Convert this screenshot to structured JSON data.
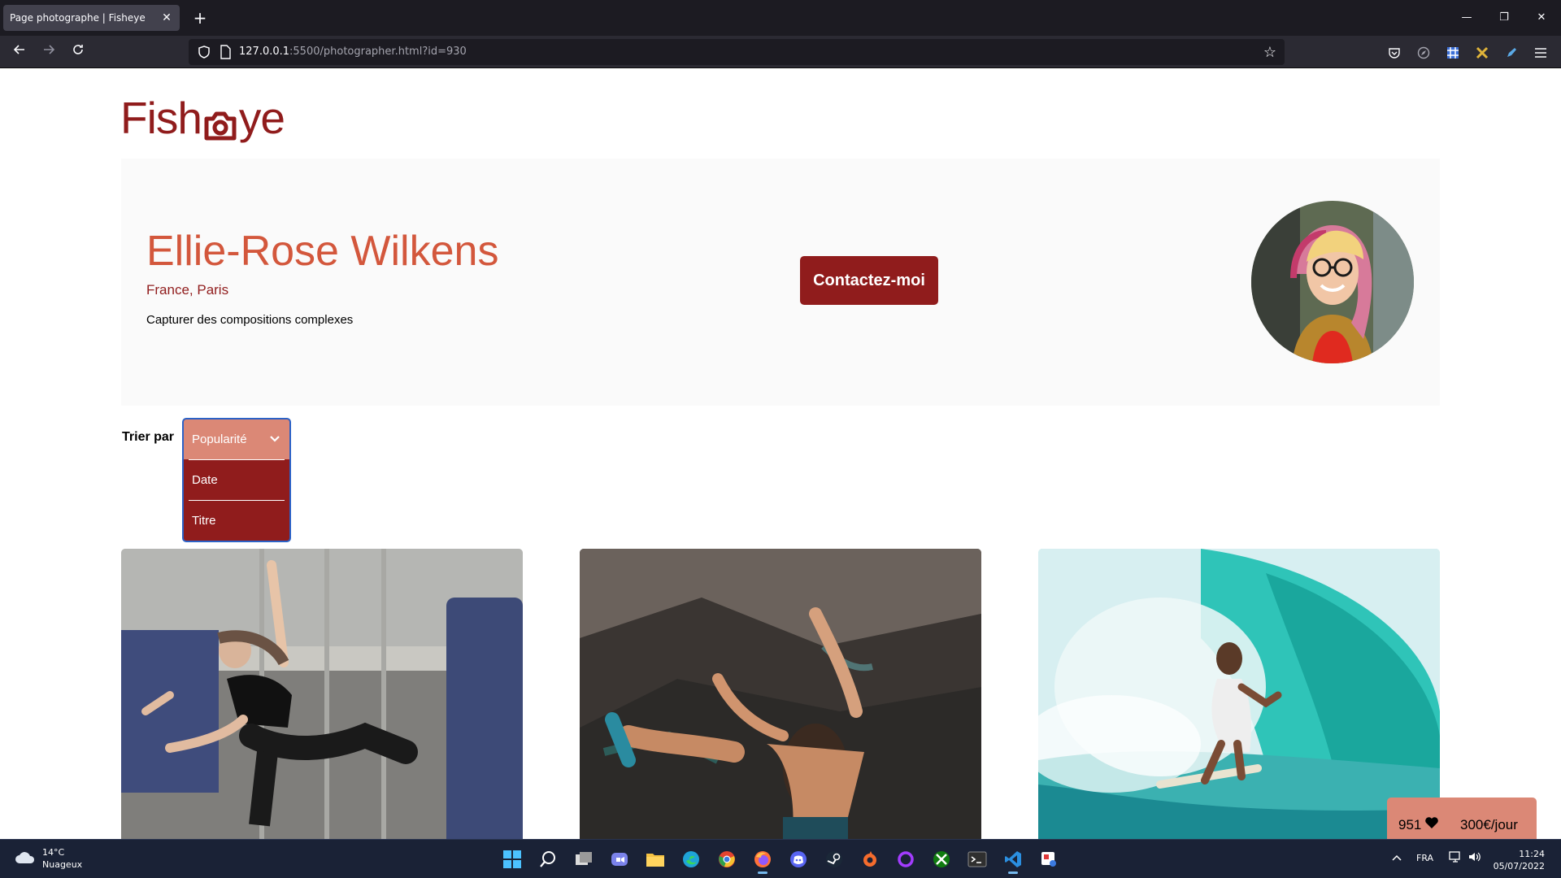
{
  "browser": {
    "tab_title": "Page photographe | Fisheye",
    "tab_close": "✕",
    "new_tab": "+",
    "url_host": "127.0.0.1",
    "url_rest": ":5500/photographer.html?id=930",
    "window_controls": {
      "minimize": "—",
      "restore": "❐",
      "close": "✕"
    }
  },
  "site": {
    "logo_left": "Fish",
    "logo_right": "ye"
  },
  "photographer": {
    "name": "Ellie-Rose Wilkens",
    "location": "France, Paris",
    "tagline": "Capturer des compositions complexes",
    "contact_label": "Contactez-moi"
  },
  "sort": {
    "label": "Trier par",
    "options": [
      {
        "label": "Popularité",
        "selected": true
      },
      {
        "label": "Date"
      },
      {
        "label": "Titre"
      }
    ]
  },
  "media": [
    {
      "icon": "sport-dance-photo"
    },
    {
      "icon": "rock-climbing-photo"
    },
    {
      "icon": "surfer-wave-photo"
    }
  ],
  "stats": {
    "likes": "951",
    "price": "300€/jour"
  },
  "taskbar": {
    "weather_temp": "14°C",
    "weather_desc": "Nuageux",
    "language": "FRA",
    "time": "11:24",
    "date": "05/07/2022"
  },
  "colors": {
    "primary": "#901c1c",
    "secondary": "#d3573c",
    "accent": "#db8876"
  }
}
